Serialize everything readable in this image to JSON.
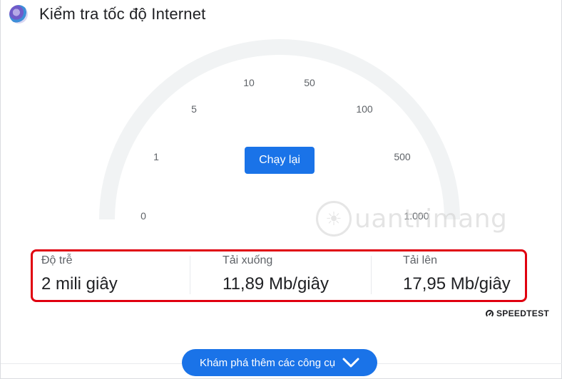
{
  "header": {
    "title": "Kiểm tra tốc độ Internet",
    "logo_icon": "speed-test-app-logo"
  },
  "gauge": {
    "ticks": [
      "0",
      "1",
      "5",
      "10",
      "50",
      "100",
      "500",
      "1.000"
    ]
  },
  "actions": {
    "run_again_label": "Chạy lại"
  },
  "results": {
    "latency": {
      "label": "Độ trễ",
      "value": "2 mili giây"
    },
    "download": {
      "label": "Tải xuống",
      "value": "11,89 Mb/giây"
    },
    "upload": {
      "label": "Tải lên",
      "value": "17,95 Mb/giây"
    }
  },
  "provider": {
    "name": "SPEEDTEST",
    "icon": "speedtest-gauge-icon"
  },
  "watermark": {
    "text": "uantrimang",
    "icon": "lightbulb-icon"
  },
  "footer": {
    "explore_label": "Khám phá thêm các công cụ",
    "icon": "chevron-down-icon"
  },
  "colors": {
    "accent": "#1a73e8",
    "highlight_border": "#e0000f",
    "gauge_track": "#f1f3f4"
  }
}
